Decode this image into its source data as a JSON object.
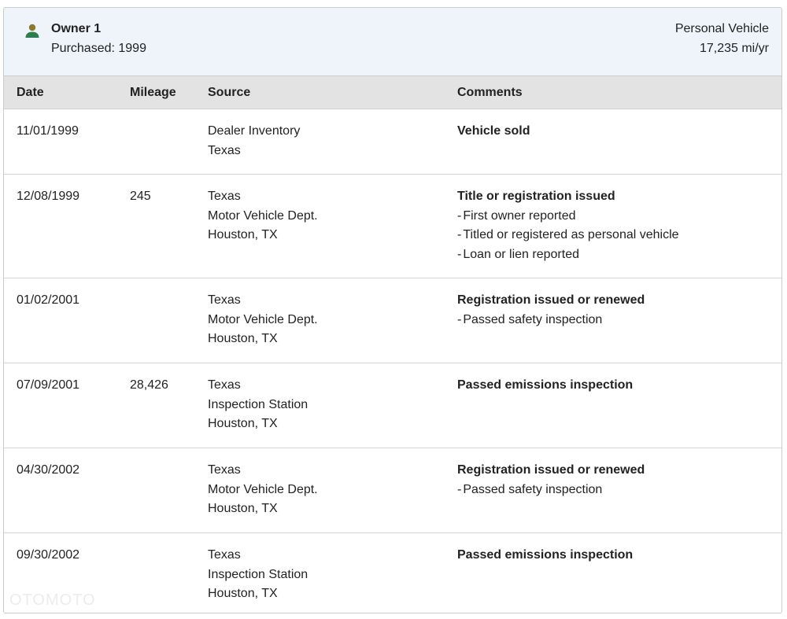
{
  "owner": {
    "name": "Owner 1",
    "purchased": "Purchased: 1999",
    "vehicle_type": "Personal Vehicle",
    "miles_per_year": "17,235 mi/yr",
    "icon": "person-icon",
    "icon_color": "#8a7a2e"
  },
  "table": {
    "headers": {
      "date": "Date",
      "mileage": "Mileage",
      "source": "Source",
      "comments": "Comments"
    },
    "rows": [
      {
        "date": "11/01/1999",
        "mileage": "",
        "source": [
          "Dealer Inventory",
          "Texas"
        ],
        "comment_title": "Vehicle sold",
        "comment_items": []
      },
      {
        "date": "12/08/1999",
        "mileage": "245",
        "source": [
          "Texas",
          "Motor Vehicle Dept.",
          "Houston, TX"
        ],
        "comment_title": "Title or registration issued",
        "comment_items": [
          "First owner reported",
          "Titled or registered as personal vehicle",
          "Loan or lien reported"
        ]
      },
      {
        "date": "01/02/2001",
        "mileage": "",
        "source": [
          "Texas",
          "Motor Vehicle Dept.",
          "Houston, TX"
        ],
        "comment_title": "Registration issued or renewed",
        "comment_items": [
          "Passed safety inspection"
        ]
      },
      {
        "date": "07/09/2001",
        "mileage": "28,426",
        "source": [
          "Texas",
          "Inspection Station",
          "Houston, TX"
        ],
        "comment_title": "Passed emissions inspection",
        "comment_items": []
      },
      {
        "date": "04/30/2002",
        "mileage": "",
        "source": [
          "Texas",
          "Motor Vehicle Dept.",
          "Houston, TX"
        ],
        "comment_title": "Registration issued or renewed",
        "comment_items": [
          "Passed safety inspection"
        ]
      },
      {
        "date": "09/30/2002",
        "mileage": "",
        "source": [
          "Texas",
          "Inspection Station",
          "Houston, TX"
        ],
        "comment_title": "Passed emissions inspection",
        "comment_items": []
      }
    ]
  },
  "watermark": "OTOMOTO"
}
